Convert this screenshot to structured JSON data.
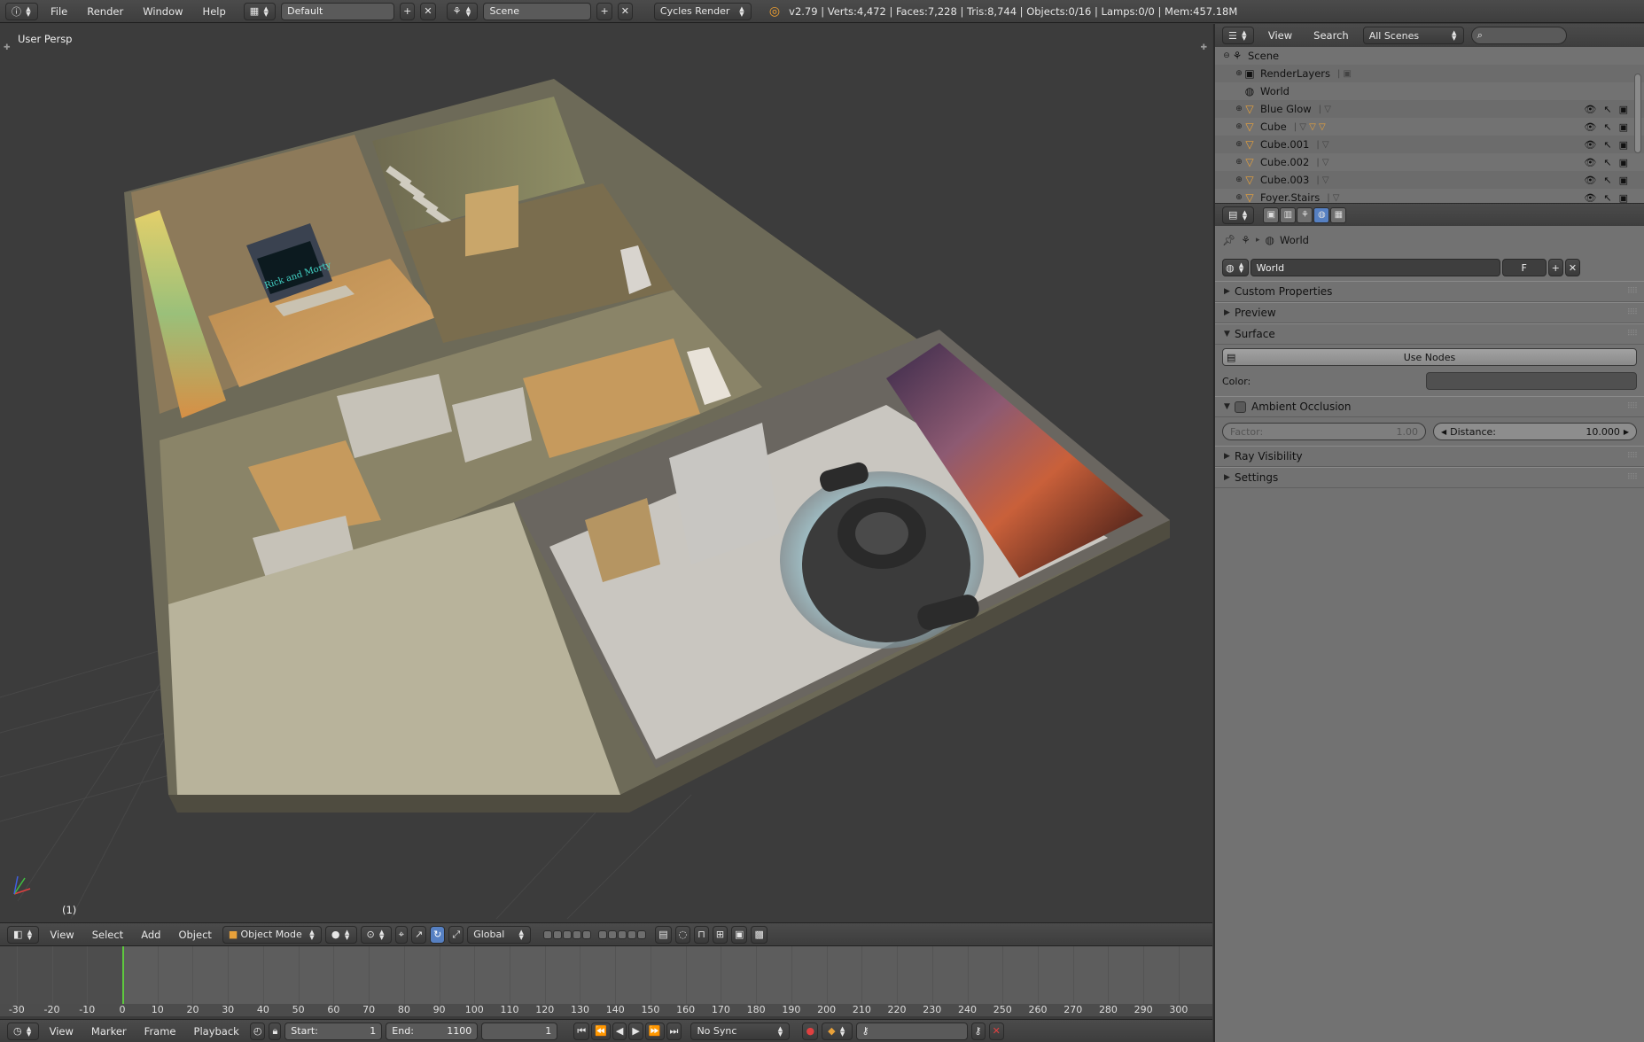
{
  "topbar": {
    "menus": [
      "File",
      "Render",
      "Window",
      "Help"
    ],
    "screen_layout": "Default",
    "scene": "Scene",
    "render_engine": "Cycles Render",
    "stats": "v2.79 | Verts:4,472 | Faces:7,228 | Tris:8,744 | Objects:0/16 | Lamps:0/0 | Mem:457.18M"
  },
  "viewport": {
    "view_label": "User Persp",
    "frame_label": "(1)",
    "poster_text": "Rick and Morty"
  },
  "view_header": {
    "menus": [
      "View",
      "Select",
      "Add",
      "Object"
    ],
    "mode": "Object Mode",
    "orientation": "Global"
  },
  "timeline": {
    "ticks": [
      "-30",
      "-20",
      "-10",
      "0",
      "10",
      "20",
      "30",
      "40",
      "50",
      "60",
      "70",
      "80",
      "90",
      "100",
      "110",
      "120",
      "130",
      "140",
      "150",
      "160",
      "170",
      "180",
      "190",
      "200",
      "210",
      "220",
      "230",
      "240",
      "250",
      "260",
      "270",
      "280",
      "290",
      "300"
    ],
    "current_frame_value": 1
  },
  "timeline_header": {
    "menus": [
      "View",
      "Marker",
      "Frame",
      "Playback"
    ],
    "start_label": "Start:",
    "start_value": "1",
    "end_label": "End:",
    "end_value": "1100",
    "current_frame": "1",
    "sync": "No Sync"
  },
  "outliner": {
    "menus": [
      "View",
      "Search"
    ],
    "display_mode": "All Scenes",
    "rows": [
      {
        "name": "Scene",
        "icon": "scene-icon"
      },
      {
        "name": "RenderLayers",
        "icon": "renderlayers-icon"
      },
      {
        "name": "World",
        "icon": "world-icon"
      },
      {
        "name": "Blue Glow",
        "icon": "mesh-object-icon"
      },
      {
        "name": "Cube",
        "icon": "mesh-object-icon"
      },
      {
        "name": "Cube.001",
        "icon": "mesh-object-icon"
      },
      {
        "name": "Cube.002",
        "icon": "mesh-object-icon"
      },
      {
        "name": "Cube.003",
        "icon": "mesh-object-icon"
      },
      {
        "name": "Foyer.Stairs",
        "icon": "mesh-object-icon"
      }
    ]
  },
  "properties": {
    "breadcrumb": "World",
    "datablock_name": "World",
    "fake_user": "F",
    "panels": {
      "custom_properties": "Custom Properties",
      "preview": "Preview",
      "surface": "Surface",
      "use_nodes": "Use Nodes",
      "color_label": "Color:",
      "ambient_occlusion": "Ambient Occlusion",
      "factor_label": "Factor:",
      "factor_value": "1.00",
      "distance_label": "Distance:",
      "distance_value": "10.000",
      "ray_visibility": "Ray Visibility",
      "settings": "Settings"
    }
  },
  "colors": {
    "accent_blue": "#5680c2",
    "playhead_green": "#5ec93e",
    "object_orange": "#e8a13a",
    "world_color_swatch": "#505050"
  }
}
